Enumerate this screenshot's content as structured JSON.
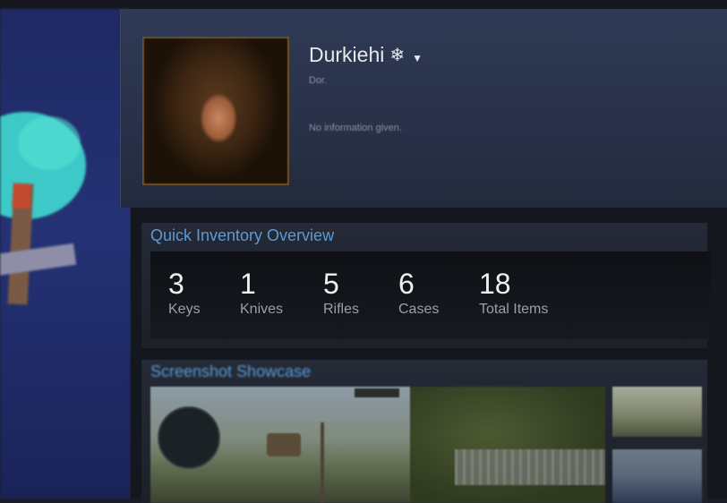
{
  "profile": {
    "username": "Durkiehi",
    "status_icon": "snowflake-icon",
    "real_name": "Dor.",
    "summary": "No information given."
  },
  "inventory": {
    "title": "Quick Inventory Overview",
    "stats": [
      {
        "value": "3",
        "label": "Keys"
      },
      {
        "value": "1",
        "label": "Knives"
      },
      {
        "value": "5",
        "label": "Rifles"
      },
      {
        "value": "6",
        "label": "Cases"
      },
      {
        "value": "18",
        "label": "Total Items"
      }
    ]
  },
  "showcase": {
    "title": "Screenshot Showcase"
  },
  "colors": {
    "accent_title": "#5d9ad6",
    "header_bg": "#2f3a55",
    "page_bg": "#14171d"
  }
}
